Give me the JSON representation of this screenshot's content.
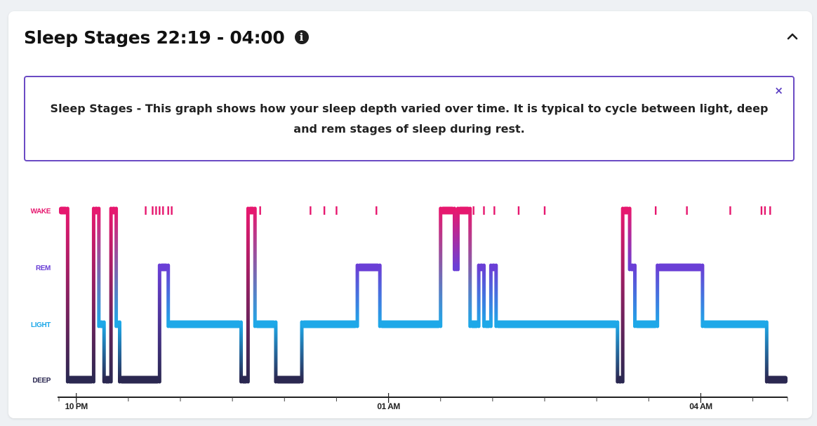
{
  "card": {
    "title": "Sleep Stages 22:19 - 04:00",
    "info_icon": "info-circle-icon",
    "collapse_icon": "chevron-up-icon",
    "description": "Sleep Stages - This graph shows how your sleep depth varied over time. It is typical to cycle between light, deep and rem stages of sleep during rest.",
    "close_label": "×"
  },
  "chart_data": {
    "type": "line",
    "title": "",
    "x_range": [
      "21:50",
      "04:50"
    ],
    "y_categories": [
      "DEEP",
      "LIGHT",
      "REM",
      "WAKE"
    ],
    "x_tick_labels": [
      {
        "label": "10 PM",
        "time": "22:00"
      },
      {
        "label": "01 AM",
        "time": "01:00"
      },
      {
        "label": "04 AM",
        "time": "04:00"
      }
    ],
    "colors": {
      "WAKE": "#e6186f",
      "REM": "#6a3fd6",
      "LIGHT": "#1ea8e8",
      "DEEP": "#2b2851"
    },
    "segments": [
      {
        "start": "21:50",
        "end": "21:55",
        "stage": "WAKE"
      },
      {
        "start": "21:55",
        "end": "22:10",
        "stage": "DEEP"
      },
      {
        "start": "22:10",
        "end": "22:13",
        "stage": "WAKE"
      },
      {
        "start": "22:13",
        "end": "22:16",
        "stage": "LIGHT"
      },
      {
        "start": "22:16",
        "end": "22:20",
        "stage": "DEEP"
      },
      {
        "start": "22:20",
        "end": "22:23",
        "stage": "WAKE"
      },
      {
        "start": "22:23",
        "end": "22:25",
        "stage": "LIGHT"
      },
      {
        "start": "22:25",
        "end": "22:48",
        "stage": "DEEP"
      },
      {
        "start": "22:48",
        "end": "22:53",
        "stage": "REM"
      },
      {
        "start": "22:53",
        "end": "23:35",
        "stage": "LIGHT"
      },
      {
        "start": "23:35",
        "end": "23:39",
        "stage": "DEEP"
      },
      {
        "start": "23:39",
        "end": "23:43",
        "stage": "WAKE"
      },
      {
        "start": "23:43",
        "end": "23:55",
        "stage": "LIGHT"
      },
      {
        "start": "23:55",
        "end": "00:10",
        "stage": "DEEP"
      },
      {
        "start": "00:10",
        "end": "00:42",
        "stage": "LIGHT"
      },
      {
        "start": "00:42",
        "end": "00:55",
        "stage": "REM"
      },
      {
        "start": "00:55",
        "end": "01:30",
        "stage": "LIGHT"
      },
      {
        "start": "01:30",
        "end": "01:38",
        "stage": "WAKE"
      },
      {
        "start": "01:38",
        "end": "01:40",
        "stage": "REM"
      },
      {
        "start": "01:40",
        "end": "01:47",
        "stage": "WAKE"
      },
      {
        "start": "01:47",
        "end": "01:52",
        "stage": "LIGHT"
      },
      {
        "start": "01:52",
        "end": "01:55",
        "stage": "REM"
      },
      {
        "start": "01:55",
        "end": "01:59",
        "stage": "LIGHT"
      },
      {
        "start": "01:59",
        "end": "02:02",
        "stage": "REM"
      },
      {
        "start": "02:02",
        "end": "03:12",
        "stage": "LIGHT"
      },
      {
        "start": "03:12",
        "end": "03:15",
        "stage": "DEEP"
      },
      {
        "start": "03:15",
        "end": "03:19",
        "stage": "WAKE"
      },
      {
        "start": "03:19",
        "end": "03:22",
        "stage": "REM"
      },
      {
        "start": "03:22",
        "end": "03:35",
        "stage": "LIGHT"
      },
      {
        "start": "03:35",
        "end": "04:01",
        "stage": "REM"
      },
      {
        "start": "04:01",
        "end": "04:38",
        "stage": "LIGHT"
      },
      {
        "start": "04:38",
        "end": "04:50",
        "stage": "DEEP"
      }
    ],
    "brief_wake_marks": [
      "22:40",
      "22:44",
      "22:46",
      "22:48",
      "22:50",
      "22:53",
      "22:55",
      "23:46",
      "24:15",
      "24:23",
      "24:30",
      "24:53",
      "25:49",
      "25:55",
      "26:01",
      "26:15",
      "26:30",
      "27:34",
      "27:52",
      "28:17",
      "28:35",
      "28:37",
      "28:40"
    ]
  }
}
